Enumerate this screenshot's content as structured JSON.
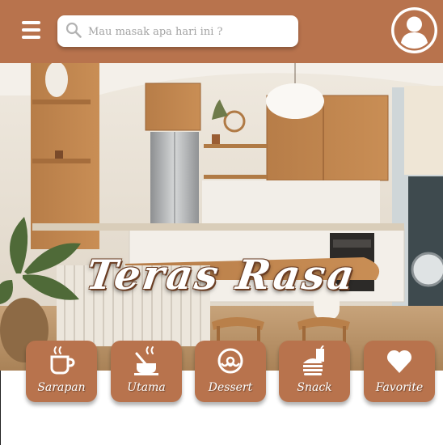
{
  "colors": {
    "primary": "#b8734d",
    "surface": "#ffffff"
  },
  "header": {
    "menu_icon": "hamburger-menu-icon",
    "search": {
      "placeholder": "Mau masak apa hari ini ?",
      "value": "",
      "icon": "search-icon"
    },
    "profile_icon": "user-avatar-icon"
  },
  "hero": {
    "title": "Teras Rasa",
    "image": "modern-kitchen-photo"
  },
  "categories": [
    {
      "label": "Sarapan",
      "icon": "coffee-cup-icon"
    },
    {
      "label": "Utama",
      "icon": "cooking-pot-icon"
    },
    {
      "label": "Dessert",
      "icon": "donut-icon"
    },
    {
      "label": "Snack",
      "icon": "burger-drink-icon"
    },
    {
      "label": "Favorite",
      "icon": "heart-icon"
    }
  ]
}
